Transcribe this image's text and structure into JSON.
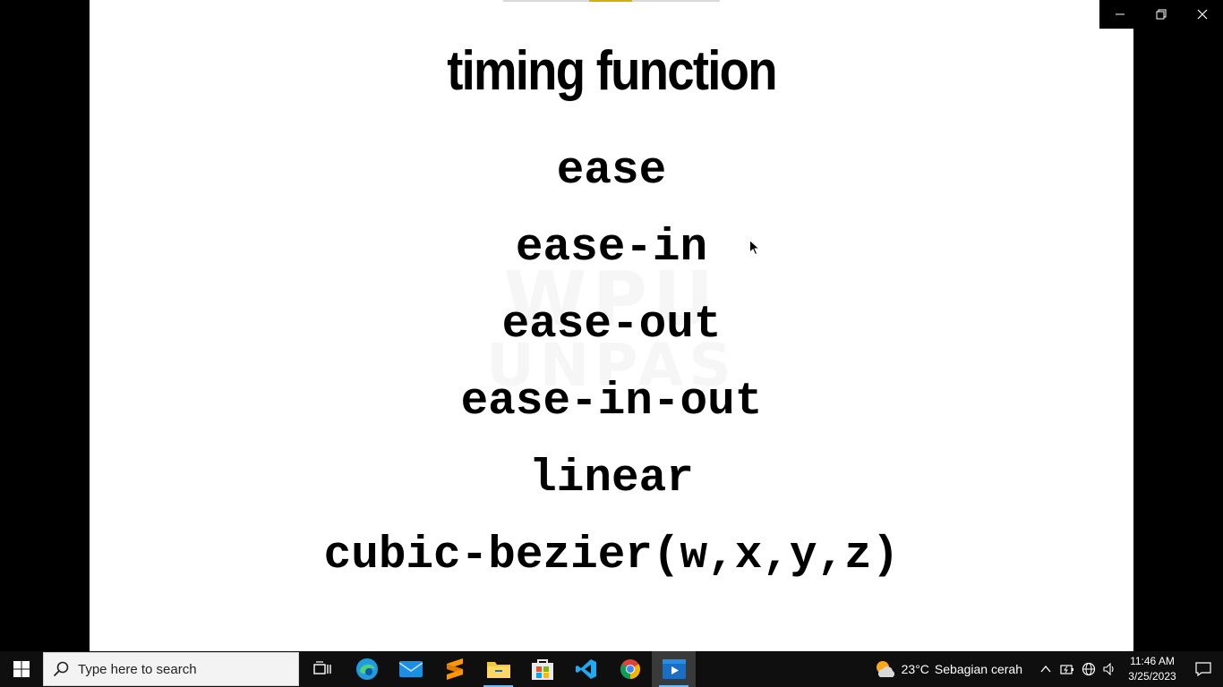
{
  "slide": {
    "title": "timing function",
    "functions": [
      "ease",
      "ease-in",
      "ease-out",
      "ease-in-out",
      "linear",
      "cubic-bezier(w,x,y,z)"
    ]
  },
  "taskbar": {
    "search_placeholder": "Type here to search",
    "apps": [
      {
        "name": "task-view",
        "icon": "task-view-icon"
      },
      {
        "name": "edge",
        "icon": "edge-icon"
      },
      {
        "name": "mail",
        "icon": "mail-icon"
      },
      {
        "name": "sublime-text",
        "icon": "sublime-icon"
      },
      {
        "name": "file-explorer",
        "icon": "folder-icon"
      },
      {
        "name": "microsoft-store",
        "icon": "store-icon"
      },
      {
        "name": "vs-code",
        "icon": "vscode-icon"
      },
      {
        "name": "chrome",
        "icon": "chrome-icon"
      },
      {
        "name": "video-player",
        "icon": "video-icon"
      }
    ],
    "weather": {
      "temp": "23°C",
      "desc": "Sebagian cerah"
    },
    "clock": {
      "time": "11:46 AM",
      "date": "3/25/2023"
    }
  },
  "colors": {
    "taskbar_bg": "#0f0f0f",
    "accent": "#76b9ed",
    "slide_bg": "#ffffff"
  }
}
